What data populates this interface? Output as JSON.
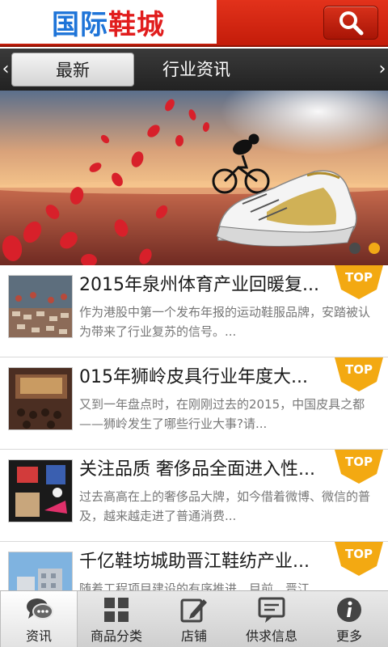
{
  "header": {
    "logo_part1": "国际",
    "logo_part2": "鞋城",
    "search_icon": "search-icon"
  },
  "tabs": {
    "left_arrow": "‹",
    "right_arrow": "›",
    "items": [
      {
        "label": "最新",
        "active": true
      },
      {
        "label": "行业资讯",
        "active": false
      }
    ]
  },
  "banner": {
    "image": "banner-image-cyclist-sneaker",
    "dots": [
      {
        "active": false,
        "color": "#4a4a4a"
      },
      {
        "active": true,
        "color": "#f2a916"
      }
    ]
  },
  "news": [
    {
      "title": "2015年泉州体育产业回暖复...",
      "desc": "作为港股中第一个发布年报的运动鞋服品牌，安踏被认为带来了行业复苏的信号。...",
      "badge": "TOP",
      "thumb": "thumb-shoe-factory"
    },
    {
      "title": "015年狮岭皮具行业年度大...",
      "desc": "又到一年盘点时，在刚刚过去的2015，中国皮具之都——狮岭发生了哪些行业大事?请...",
      "badge": "TOP",
      "thumb": "thumb-conference-hall"
    },
    {
      "title": "关注品质 奢侈品全面进入性...",
      "desc": "过去高高在上的奢侈品大牌，如今借着微博、微信的普及，越来越走进了普通消费...",
      "badge": "TOP",
      "thumb": "thumb-luxury-collage"
    },
    {
      "title": "千亿鞋坊城助晋江鞋纺产业...",
      "desc": "随着工程项目建设的有序推进，目前，晋江...",
      "badge": "TOP",
      "thumb": "thumb-building"
    }
  ],
  "bottom_nav": [
    {
      "label": "资讯",
      "icon": "chat-bubbles-icon",
      "active": true
    },
    {
      "label": "商品分类",
      "icon": "grid-icon",
      "active": false
    },
    {
      "label": "店铺",
      "icon": "edit-icon",
      "active": false
    },
    {
      "label": "供求信息",
      "icon": "message-icon",
      "active": false
    },
    {
      "label": "更多",
      "icon": "info-icon",
      "active": false
    }
  ],
  "colors": {
    "header_red": "#d8281a",
    "badge_orange": "#f3a912",
    "tab_dark": "#2c2c2c"
  }
}
